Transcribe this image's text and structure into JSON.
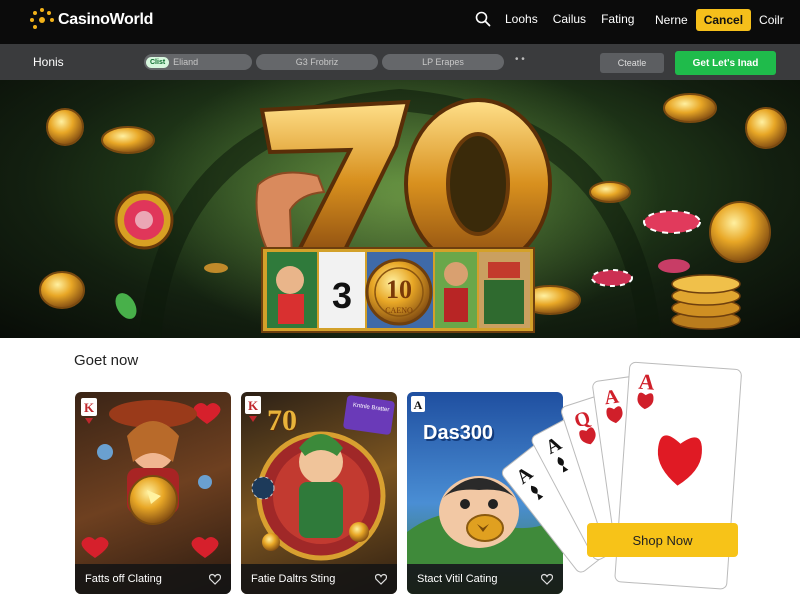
{
  "header": {
    "logo_text": "CasinoWorld",
    "nav": [
      "Loohs",
      "Cailus",
      "Fating"
    ],
    "right_link_1": "Nerne",
    "cancel_label": "Cancel",
    "right_link_2": "Coilr"
  },
  "subbar": {
    "home": "Honis",
    "tabs": [
      {
        "tag": "Clist",
        "label": "Eliand"
      },
      {
        "label": "G3 Frobriz"
      },
      {
        "label": "LP Erapes"
      }
    ],
    "more": "• •",
    "create_label": "Cteatle",
    "cta_label": "Get Let's Inad"
  },
  "hero": {
    "big_number": "70",
    "reel_number": "3",
    "coin_number": "10",
    "coin_text": "CAENO"
  },
  "section": {
    "title": "Goet now",
    "cards": [
      {
        "title": "Fatts off Clating",
        "corner": "K"
      },
      {
        "title": "Fatie Daltrs Sting",
        "corner": "K",
        "badge": "Kntnle Bratter",
        "number": "70"
      },
      {
        "title": "Stact Vitil Cating",
        "corner": "A",
        "headline": "Das300"
      }
    ],
    "shop_label": "Shop Now",
    "playing_cards": [
      "A",
      "A",
      "Q",
      "A",
      "A"
    ]
  },
  "colors": {
    "accent_yellow": "#f7c318",
    "accent_green": "#1fbb4b",
    "header_bg": "#0b0b0b",
    "subbar_bg": "#3a3b3d"
  }
}
